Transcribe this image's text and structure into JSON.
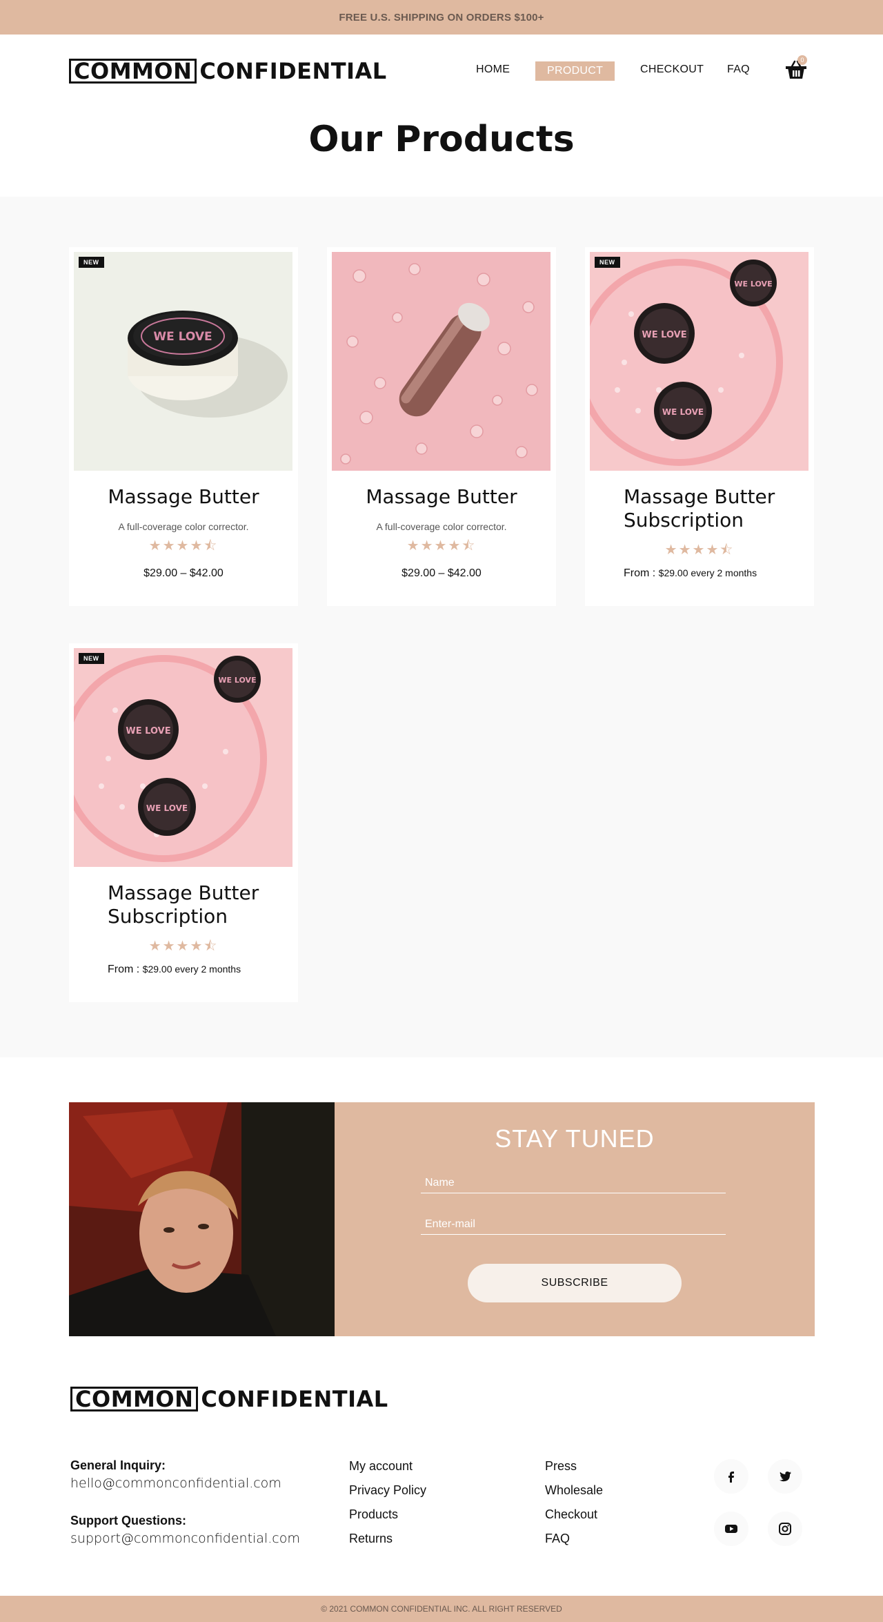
{
  "announcement": "FREE U.S. SHIPPING ON ORDERS $100+",
  "brand": {
    "logo_box": "COMMON",
    "logo_rest": "CONFIDENTIAL"
  },
  "nav": {
    "home": "HOME",
    "product": "PRODUCT",
    "checkout": "CHECKOUT",
    "faq": "FAQ",
    "cart_count": "0"
  },
  "page_title": "Our Products",
  "products": [
    {
      "badge": "NEW",
      "name": "Massage Butter",
      "desc": "A full-coverage color corrector.",
      "stars": "★★★★⯪",
      "price": "$29.00 – $42.00",
      "image_alt": "massage butter jar with WE LOVE label"
    },
    {
      "badge": "",
      "name": "Massage Butter",
      "desc": "A full-coverage color corrector.",
      "stars": "★★★★⯪",
      "price": "$29.00 – $42.00",
      "image_alt": "massager on pink background"
    },
    {
      "badge": "NEW",
      "name": "Massage Butter Subscription",
      "stars": "★★★★⯪",
      "price_prefix": "From : ",
      "price": "$29.00 every 2 months",
      "image_alt": "three WE LOVE tins on pink tray"
    },
    {
      "badge": "NEW",
      "name": "Massage Butter Subscription",
      "stars": "★★★★⯪",
      "price_prefix": "From : ",
      "price": "$29.00 every 2 months",
      "image_alt": "three WE LOVE tins on pink tray"
    }
  ],
  "newsletter": {
    "title": "STAY TUNED",
    "name_placeholder": "Name",
    "email_placeholder": "Enter-mail",
    "button": "SUBSCRIBE"
  },
  "footer": {
    "general_label": "General Inquiry:",
    "general_email": "hello@commonconfidential.com",
    "support_label": "Support Questions:",
    "support_email": "support@commonconfidential.com",
    "col1": [
      "My account",
      "Privacy Policy",
      "Products",
      "Returns"
    ],
    "col2": [
      "Press",
      "Wholesale",
      "Checkout",
      "FAQ"
    ],
    "social": [
      "facebook-icon",
      "twitter-icon",
      "youtube-icon",
      "instagram-icon"
    ],
    "copyright": "© 2021 COMMON CONFIDENTIAL INC. ALL RIGHT RESERVED"
  },
  "colors": {
    "accent": "#dfb9a0",
    "section_bg": "#f9f9f9",
    "text": "#111111"
  }
}
